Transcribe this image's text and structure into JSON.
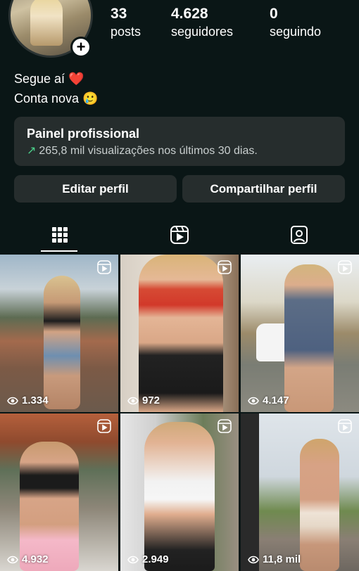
{
  "profile": {
    "stats": [
      {
        "value": "33",
        "label": "posts"
      },
      {
        "value": "4.628",
        "label": "seguidores"
      },
      {
        "value": "0",
        "label": "seguindo"
      }
    ],
    "bio_line1": "Segue aí ❤️",
    "bio_line2": "Conta nova 🥲",
    "add_symbol": "+"
  },
  "panel": {
    "title": "Painel profissional",
    "subtitle": "265,8 mil visualizações nos últimos 30 dias.",
    "trend_icon": "trending-up-arrow",
    "trend_color": "#4bd08a"
  },
  "actions": {
    "edit_label": "Editar perfil",
    "share_label": "Compartilhar perfil"
  },
  "tabs": [
    {
      "icon": "grid-icon",
      "active": true
    },
    {
      "icon": "reels-icon",
      "active": false
    },
    {
      "icon": "tagged-icon",
      "active": false
    }
  ],
  "posts": [
    {
      "views": "1.334",
      "type": "reel"
    },
    {
      "views": "972",
      "type": "reel"
    },
    {
      "views": "4.147",
      "type": "reel"
    },
    {
      "views": "4.932",
      "type": "reel"
    },
    {
      "views": "2.949",
      "type": "reel"
    },
    {
      "views": "11,8 mil",
      "type": "reel"
    }
  ],
  "colors": {
    "background": "#0a1616",
    "card": "#262d2d",
    "text": "#ffffff"
  }
}
